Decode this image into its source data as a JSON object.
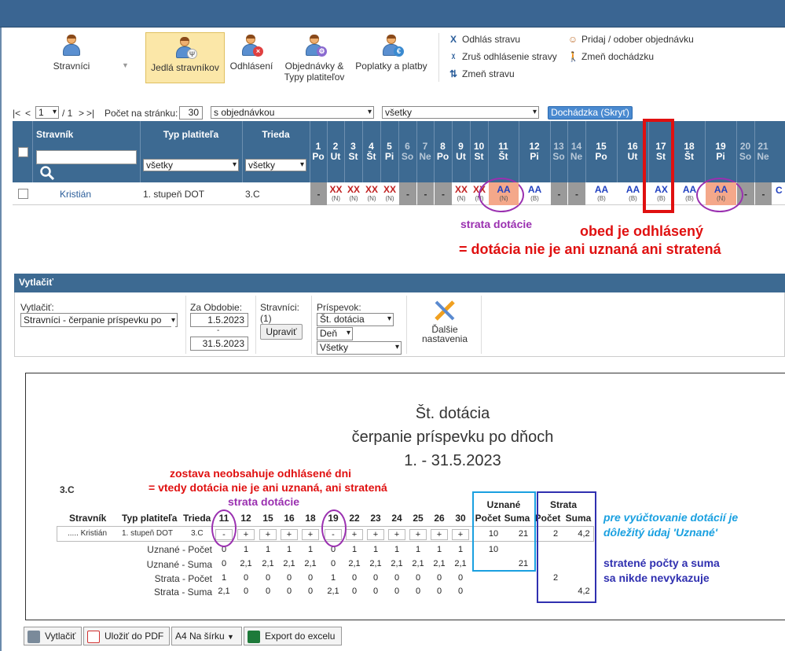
{
  "toolbar": {
    "stravnici": "Stravníci",
    "jedla": "Jedlá stravníkov",
    "odhlasenie": "Odhlásení",
    "objednavky": "Objednávky &",
    "objednavky2": "Typy platiteľov",
    "poplatky": "Poplatky a platby",
    "actions_left": [
      "Odhlás stravu",
      "Zruš odhlásenie stravy",
      "Zmeň stravu"
    ],
    "actions_right": [
      "Pridaj / odober objednávku",
      "Zmeň dochádzku"
    ]
  },
  "pager": {
    "first": "|<",
    "prev": "<",
    "page": "1",
    "of": "/ 1",
    "next": ">",
    "last": ">|",
    "per_page_label": "Počet na stránku:",
    "per_page": "30",
    "filter1": "s objednávkou",
    "filter2": "všetky",
    "attendance_btn": "Dochádzka (Skryť)"
  },
  "grid": {
    "col_stravnik": "Stravník",
    "col_typ": "Typ platiteľa",
    "col_trieda": "Trieda",
    "typ_filter": "všetky",
    "trieda_filter": "všetky",
    "days": [
      {
        "n": "1",
        "d": "Po"
      },
      {
        "n": "2",
        "d": "Ut"
      },
      {
        "n": "3",
        "d": "St"
      },
      {
        "n": "4",
        "d": "Št"
      },
      {
        "n": "5",
        "d": "Pi"
      },
      {
        "n": "6",
        "d": "So"
      },
      {
        "n": "7",
        "d": "Ne"
      },
      {
        "n": "8",
        "d": "Po"
      },
      {
        "n": "9",
        "d": "Ut"
      },
      {
        "n": "10",
        "d": "St"
      },
      {
        "n": "11",
        "d": "Št"
      },
      {
        "n": "12",
        "d": "Pi"
      },
      {
        "n": "13",
        "d": "So"
      },
      {
        "n": "14",
        "d": "Ne"
      },
      {
        "n": "15",
        "d": "Po"
      },
      {
        "n": "16",
        "d": "Ut"
      },
      {
        "n": "17",
        "d": "St"
      },
      {
        "n": "18",
        "d": "Št"
      },
      {
        "n": "19",
        "d": "Pi"
      },
      {
        "n": "20",
        "d": "So"
      },
      {
        "n": "21",
        "d": "Ne"
      }
    ],
    "row": {
      "name": "Kristián",
      "typ": "1. stupeň DOT",
      "trieda": "3.C",
      "cells": [
        {
          "v": "-",
          "s": ""
        },
        {
          "v": "XX",
          "s": "(N)"
        },
        {
          "v": "XX",
          "s": "(N)"
        },
        {
          "v": "XX",
          "s": "(N)"
        },
        {
          "v": "XX",
          "s": "(N)"
        },
        {
          "v": "-",
          "s": ""
        },
        {
          "v": "-",
          "s": ""
        },
        {
          "v": "-",
          "s": ""
        },
        {
          "v": "XX",
          "s": "(N)"
        },
        {
          "v": "XX",
          "s": "(N)"
        },
        {
          "v": "AA",
          "s": "(N)"
        },
        {
          "v": "AA",
          "s": "(B)"
        },
        {
          "v": "-",
          "s": ""
        },
        {
          "v": "-",
          "s": ""
        },
        {
          "v": "AA",
          "s": "(B)"
        },
        {
          "v": "AA",
          "s": "(B)"
        },
        {
          "v": "AX",
          "s": "(B)"
        },
        {
          "v": "AA",
          "s": "(B)"
        },
        {
          "v": "AA",
          "s": "(N)"
        },
        {
          "v": "-",
          "s": ""
        },
        {
          "v": "-",
          "s": ""
        }
      ],
      "tail": "C"
    }
  },
  "annotations": {
    "strata1": "strata dotácie",
    "obed1": "obed je odhlásený",
    "obed2": "= dotácia nie je ani uznaná ani stratená",
    "zostava1": "zostava neobsahuje odhlásené dni",
    "zostava2": "= vtedy dotácia nie je ani uznaná, ani stratená",
    "strata2": "strata dotácie",
    "pre1": "pre vyúčtovanie dotácií je",
    "pre2": "dôležitý údaj 'Uznané'",
    "strat1": "stratené počty a suma",
    "strat2": "sa nikde nevykazuje"
  },
  "print": {
    "title": "Vytlačiť",
    "vytlacit_label": "Vytlačiť:",
    "vytlacit_value": "Stravníci - čerpanie príspevku po",
    "obdobie_label": "Za Obdobie:",
    "date_from": "1.5.2023",
    "dash": "-",
    "date_to": "31.5.2023",
    "stravnici_label": "Stravníci:",
    "stravnici_count": "(1)",
    "upravit": "Upraviť",
    "prispevok_label": "Príspevok:",
    "prispevok_value": "Št. dotácia",
    "period": "Deň",
    "scope": "Všetky",
    "dalsie1": "Ďalšie",
    "dalsie2": "nastavenia"
  },
  "report": {
    "title1": "Št. dotácia",
    "title2": "čerpanie príspevku po dňoch",
    "title3": "1. - 31.5.2023",
    "class": "3.C",
    "h_stravnik": "Stravník",
    "h_typ": "Typ platiteľa",
    "h_trieda": "Trieda",
    "days": [
      "11",
      "12",
      "15",
      "16",
      "18",
      "19",
      "22",
      "23",
      "24",
      "25",
      "26",
      "30"
    ],
    "uznane": "Uznané",
    "strata": "Strata",
    "pocet": "Počet",
    "suma": "Suma",
    "row_name": "..... Kristián",
    "row_typ": "1. stupeň DOT",
    "row_trieda": "3.C",
    "row_vals": [
      "-",
      "+",
      "+",
      "+",
      "+",
      "-",
      "+",
      "+",
      "+",
      "+",
      "+",
      "+"
    ],
    "row_u_pocet": "10",
    "row_u_suma": "21",
    "row_s_pocet": "2",
    "row_s_suma": "4,2",
    "sum_labels": [
      "Uznané - Počet",
      "Uznané - Suma",
      "Strata - Počet",
      "Strata - Suma"
    ],
    "sum_rows": [
      [
        "0",
        "1",
        "1",
        "1",
        "1",
        "0",
        "1",
        "1",
        "1",
        "1",
        "1",
        "1"
      ],
      [
        "0",
        "2,1",
        "2,1",
        "2,1",
        "2,1",
        "0",
        "2,1",
        "2,1",
        "2,1",
        "2,1",
        "2,1",
        "2,1"
      ],
      [
        "1",
        "0",
        "0",
        "0",
        "0",
        "1",
        "0",
        "0",
        "0",
        "0",
        "0",
        "0"
      ],
      [
        "2,1",
        "0",
        "0",
        "0",
        "0",
        "2,1",
        "0",
        "0",
        "0",
        "0",
        "0",
        "0"
      ]
    ],
    "sum_u_pocet": "10",
    "sum_u_suma": "21",
    "sum_s_pocet": "2",
    "sum_s_suma": "4,2"
  },
  "bottom": {
    "print": "Vytlačiť",
    "pdf": "Uložiť do PDF",
    "format": "A4 Na šírku",
    "excel": "Export do excelu"
  },
  "colors": {
    "header": "#3d6a92",
    "accent": "#4a8ad0",
    "red": "#e01010",
    "purple": "#9a30b0",
    "cyan": "#1aa0e0",
    "navy": "#3030b0"
  }
}
